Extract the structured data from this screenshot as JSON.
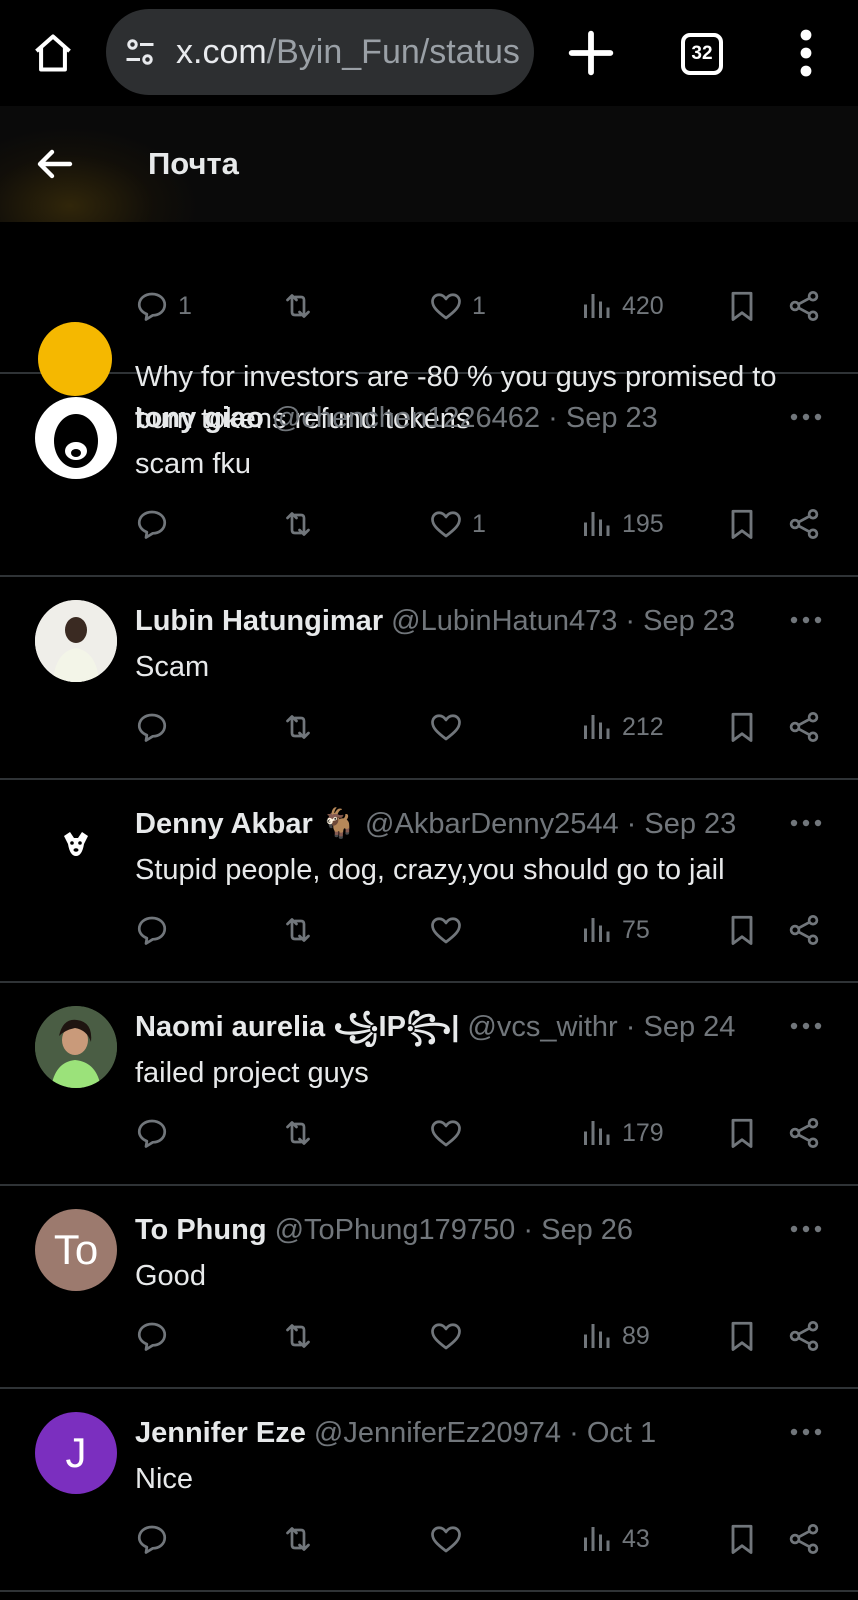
{
  "browser": {
    "url_host": "x.com",
    "url_path": "/Byin_Fun/status",
    "tab_count": "32"
  },
  "header": {
    "title": "Почта"
  },
  "partial_post": {
    "text": "Why for investors are -80 % you guys promised to burn tokens refund tokens",
    "replies": "1",
    "likes": "1",
    "views": "420"
  },
  "posts": [
    {
      "name": "tony giao",
      "handle": "@chenchen1226462",
      "dot": "·",
      "date": "Sep 23",
      "text": "scam fku",
      "replies": "",
      "likes": "1",
      "views": "195"
    },
    {
      "name": "Lubin Hatungimar",
      "handle": "@LubinHatun473",
      "dot": "·",
      "date": "Sep 23",
      "text": "Scam",
      "replies": "",
      "likes": "",
      "views": "212"
    },
    {
      "name": "Denny Akbar 🐐",
      "handle": "@AkbarDenny2544",
      "dot": "·",
      "date": "Sep 23",
      "text": "Stupid people, dog, crazy,you should go to jail",
      "replies": "",
      "likes": "",
      "views": "75"
    },
    {
      "name": "Naomi aurelia ꧁IP꧂|",
      "handle": "@vcs_withr",
      "dot": "·",
      "date": "Sep 24",
      "text": "failed project guys",
      "replies": "",
      "likes": "",
      "views": "179"
    },
    {
      "name": "To Phung",
      "handle": "@ToPhung179750",
      "dot": "·",
      "date": "Sep 26",
      "text": "Good",
      "replies": "",
      "likes": "",
      "views": "89",
      "avatar_letter": "To",
      "avatar_color": "#9c7a6e"
    },
    {
      "name": "Jennifer Eze",
      "handle": "@JenniferEz20974",
      "dot": "·",
      "date": "Oct 1",
      "text": "Nice",
      "replies": "",
      "likes": "",
      "views": "43",
      "avatar_letter": "J",
      "avatar_color": "#7b2fbf"
    }
  ],
  "colors": {
    "background": "#000000",
    "text": "#e7e9ea",
    "muted": "#71767b",
    "divider": "#2f3336"
  }
}
